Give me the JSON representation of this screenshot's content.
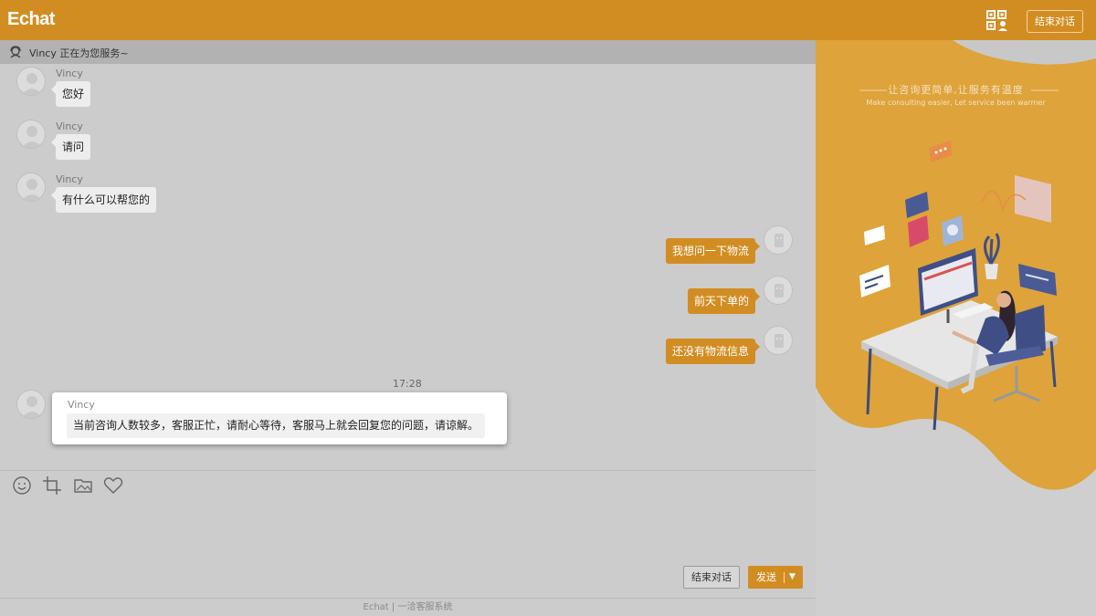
{
  "header": {
    "logo": "Echat",
    "end_button": "结束对话",
    "qr_icon": "qrcode-user-icon"
  },
  "service_bar": {
    "text": "Vincy 正在为您服务~",
    "icon": "agent-headset-icon"
  },
  "messages": [
    {
      "side": "in",
      "sender": "Vincy",
      "text": "您好"
    },
    {
      "side": "in",
      "sender": "Vincy",
      "text": "请问"
    },
    {
      "side": "in",
      "sender": "Vincy",
      "text": "有什么可以帮您的"
    },
    {
      "side": "out",
      "text": "我想问一下物流"
    },
    {
      "side": "out",
      "text": "前天下单的"
    },
    {
      "side": "out",
      "text": "还没有物流信息"
    }
  ],
  "timestamp": "17:28",
  "highlight_message": {
    "sender": "Vincy",
    "text": "当前咨询人数较多，客服正忙，请耐心等待，客服马上就会回复您的问题，请谅解。"
  },
  "toolbar": {
    "icons": [
      "emoji-icon",
      "crop-screenshot-icon",
      "image-folder-icon",
      "heart-icon"
    ]
  },
  "actions": {
    "end_label": "结束对话",
    "send_label": "发送",
    "send_caret": "▼"
  },
  "footer": {
    "brand": "Echat",
    "text": "一洽客服系统"
  },
  "promo": {
    "title_cn": "让咨询更简单,让服务有温度",
    "title_en": "Make consulting easier, Let service been warmer"
  },
  "colors": {
    "accent": "#d28d22",
    "overlay_gray": "#cccccc",
    "bubble_in": "#ededed"
  }
}
